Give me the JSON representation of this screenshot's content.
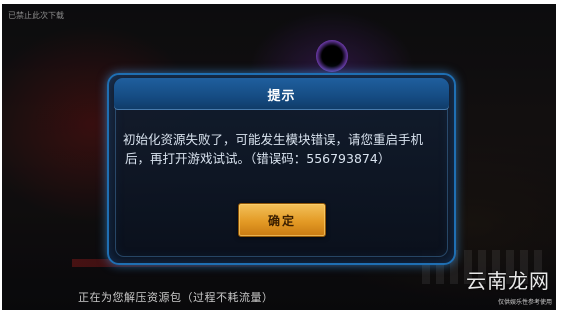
{
  "background": {
    "top_text": "已禁止此次下载"
  },
  "dialog": {
    "title": "提示",
    "message_line1": "初始化资源失败了，可能发生模块错误，请您重启手机",
    "message_line2": "后，再打开游戏试试。（错误码：556793874）",
    "confirm_label": "确定"
  },
  "status": {
    "text": "正在为您解压资源包（过程不耗流量）"
  },
  "watermark": {
    "site_name": "云南龙网",
    "caption": "仅供娱乐性参考使用"
  },
  "colors": {
    "dialog_border": "#1f6fb3",
    "title_bar": "#154b82",
    "button": "#e39a25"
  }
}
